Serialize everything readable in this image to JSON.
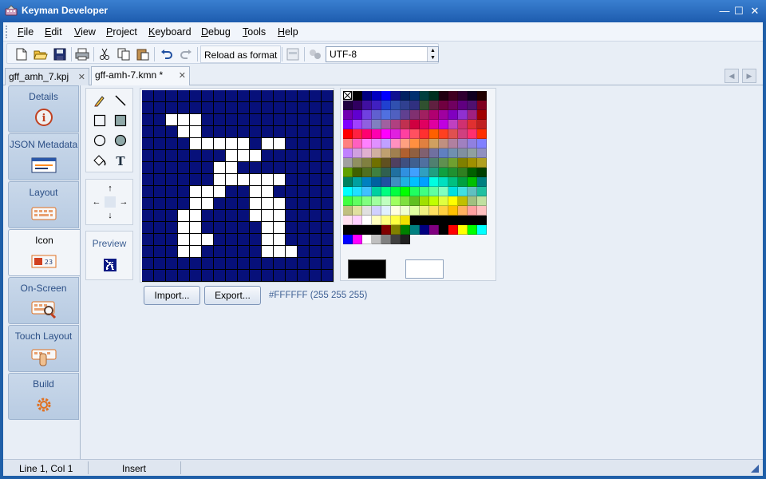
{
  "window": {
    "title": "Keyman Developer",
    "minimize": "—",
    "maximize": "☐",
    "close": "✕"
  },
  "menu": [
    "File",
    "Edit",
    "View",
    "Project",
    "Keyboard",
    "Debug",
    "Tools",
    "Help"
  ],
  "toolbar": {
    "reload_label": "Reload as format",
    "encoding": "UTF-8",
    "icons": [
      "new-file-icon",
      "open-folder-icon",
      "save-icon",
      "print-icon",
      "cut-icon",
      "copy-icon",
      "paste-icon",
      "undo-icon",
      "redo-icon"
    ]
  },
  "tabs": [
    {
      "label": "gff_amh_7.kpj",
      "close": "✕",
      "active": false
    },
    {
      "label": "gff-amh-7.kmn *",
      "close": "✕",
      "active": true
    }
  ],
  "sidebar": [
    {
      "label": "Details",
      "icon": "info-icon"
    },
    {
      "label": "JSON Metadata",
      "icon": "json-metadata-icon"
    },
    {
      "label": "Layout",
      "icon": "keyboard-icon"
    },
    {
      "label": "Icon",
      "icon": "icon-editor-icon"
    },
    {
      "label": "On-Screen",
      "icon": "on-screen-keyboard-icon"
    },
    {
      "label": "Touch Layout",
      "icon": "touch-layout-icon"
    },
    {
      "label": "Build",
      "icon": "build-gear-icon"
    }
  ],
  "active_sidebar": "Icon",
  "icon_editor": {
    "tools": [
      "pencil-tool-icon",
      "line-tool-icon",
      "rectangle-tool-icon",
      "filled-rectangle-tool-icon",
      "ellipse-tool-icon",
      "filled-ellipse-tool-icon",
      "fill-tool-icon",
      "text-tool-icon"
    ],
    "shift_arrows": [
      "↑",
      "←",
      "→",
      "↓"
    ],
    "preview_label": "Preview",
    "import_label": "Import...",
    "export_label": "Export...",
    "color_readout": "#FFFFFF (255 255 255)",
    "foreground_color": "#000000",
    "background_color": "#FFFFFF",
    "canvas_color": "#07107A",
    "pixel_rows": [
      "................",
      "................",
      "..###...........",
      "...##...........",
      "....#####.##....",
      ".......###......",
      "......##........",
      "......######....",
      "....###..##.....",
      "....##...###....",
      "...##....###....",
      "...##.....##....",
      "...###....##....",
      "...##.....###...",
      "................",
      "................"
    ]
  },
  "palette": [
    [
      "#ffffff",
      "#000000",
      "#000080",
      "#0000c0",
      "#0000ff",
      "#101090",
      "#002060",
      "#003070",
      "#004040",
      "#003020",
      "#200010",
      "#400020",
      "#300030",
      "#100020",
      "#200000"
    ],
    [
      "#200040",
      "#300060",
      "#4010a0",
      "#4020c0",
      "#2040d0",
      "#3050b0",
      "#304090",
      "#303080",
      "#305030",
      "#602040",
      "#700040",
      "#700060",
      "#600080",
      "#501070",
      "#800020"
    ],
    [
      "#7000b0",
      "#6000d0",
      "#7040e0",
      "#6060d0",
      "#5070e0",
      "#5060c0",
      "#604090",
      "#803070",
      "#a02060",
      "#b00070",
      "#a000a0",
      "#8000c0",
      "#9030d0",
      "#a02080",
      "#a00000"
    ],
    [
      "#8000ff",
      "#a040ff",
      "#9060e0",
      "#8080c0",
      "#a060a0",
      "#b04080",
      "#c03050",
      "#d00040",
      "#e00060",
      "#e000a0",
      "#c000e0",
      "#c040c0",
      "#d03070",
      "#e03030",
      "#c02020"
    ],
    [
      "#ff0000",
      "#ff2040",
      "#ff0070",
      "#ff00b0",
      "#ff00ff",
      "#e020e0",
      "#ff40a0",
      "#ff5060",
      "#ff3030",
      "#ff6000",
      "#ff4020",
      "#e05050",
      "#d04080",
      "#ff3070",
      "#ff3000"
    ],
    [
      "#ff8080",
      "#ff60c0",
      "#ff80ff",
      "#e090ff",
      "#c0a0ff",
      "#ff90c0",
      "#ffa080",
      "#ff9040",
      "#e08040",
      "#d0a060",
      "#c09080",
      "#b080a0",
      "#a080c0",
      "#9080e0",
      "#8080ff"
    ],
    [
      "#c080ff",
      "#d0a0e0",
      "#e0b0d0",
      "#d0b0a0",
      "#c0a070",
      "#a08050",
      "#b06030",
      "#906040",
      "#806070",
      "#7070a0",
      "#6080c0",
      "#7090b0",
      "#8090a0",
      "#90a0a0",
      "#9090c0"
    ],
    [
      "#a0a0a0",
      "#909060",
      "#808040",
      "#707000",
      "#605020",
      "#504060",
      "#405080",
      "#406090",
      "#5070a0",
      "#508070",
      "#609050",
      "#70a030",
      "#808000",
      "#a09000",
      "#b0a020"
    ],
    [
      "#60a000",
      "#406000",
      "#507020",
      "#408040",
      "#306050",
      "#2070a0",
      "#3090e0",
      "#40a0ff",
      "#30a0c0",
      "#20a080",
      "#10a040",
      "#209030",
      "#308020",
      "#006000",
      "#004000"
    ],
    [
      "#008060",
      "#00a0a0",
      "#0080c0",
      "#0060a0",
      "#2050a0",
      "#4090c0",
      "#20b0e0",
      "#00c0ff",
      "#00a0ff",
      "#00ffe0",
      "#00e0c0",
      "#00c080",
      "#00a040",
      "#00c000",
      "#008080"
    ],
    [
      "#00ffff",
      "#20e0ff",
      "#40c0ff",
      "#00d0a0",
      "#00ff80",
      "#00ff40",
      "#00ff00",
      "#20ff60",
      "#40ff80",
      "#60ffa0",
      "#80ffc0",
      "#00e0e0",
      "#40e0e0",
      "#60c0c0",
      "#20c0a0"
    ],
    [
      "#40ff40",
      "#60ff60",
      "#80ff80",
      "#a0ffa0",
      "#c0ffc0",
      "#a0ff60",
      "#80e040",
      "#60c020",
      "#a0e000",
      "#c0ff00",
      "#e0ff40",
      "#ffff00",
      "#c0c000",
      "#a0c080",
      "#c0e0a0"
    ],
    [
      "#c0c080",
      "#e0e0a0",
      "#e0e0e0",
      "#d0d0ff",
      "#e0f0ff",
      "#ffffe0",
      "#f0ffd0",
      "#e0ffa0",
      "#f0f080",
      "#ffe060",
      "#ffd040",
      "#ffc000",
      "#ffb060",
      "#ffa0a0",
      "#ffc0c0"
    ],
    [
      "#ffe0f0",
      "#ffd0ff",
      "#ffffff",
      "#ffffc0",
      "#ffff80",
      "#ffff40",
      "#f0e000",
      "#000000",
      "#000000",
      "#000000",
      "#000000",
      "#000000",
      "#000000",
      "#000000",
      "#000000"
    ],
    [
      "#000000",
      "#000000",
      "#000000",
      "#000000",
      "#800000",
      "#808000",
      "#008000",
      "#008080",
      "#000080",
      "#800080",
      "#000000",
      "#ff0000",
      "#ffff00",
      "#00ff00",
      "#00ffff"
    ],
    [
      "#0000ff",
      "#ff00ff",
      "#ffffff",
      "#c0c0c0",
      "#808080",
      "#404040",
      "#202020",
      "#f2f5f9",
      "#f2f5f9",
      "#f2f5f9",
      "#f2f5f9",
      "#f2f5f9",
      "#f2f5f9",
      "#f2f5f9",
      "#f2f5f9"
    ]
  ],
  "status": {
    "position": "Line 1, Col 1",
    "mode": "Insert"
  }
}
